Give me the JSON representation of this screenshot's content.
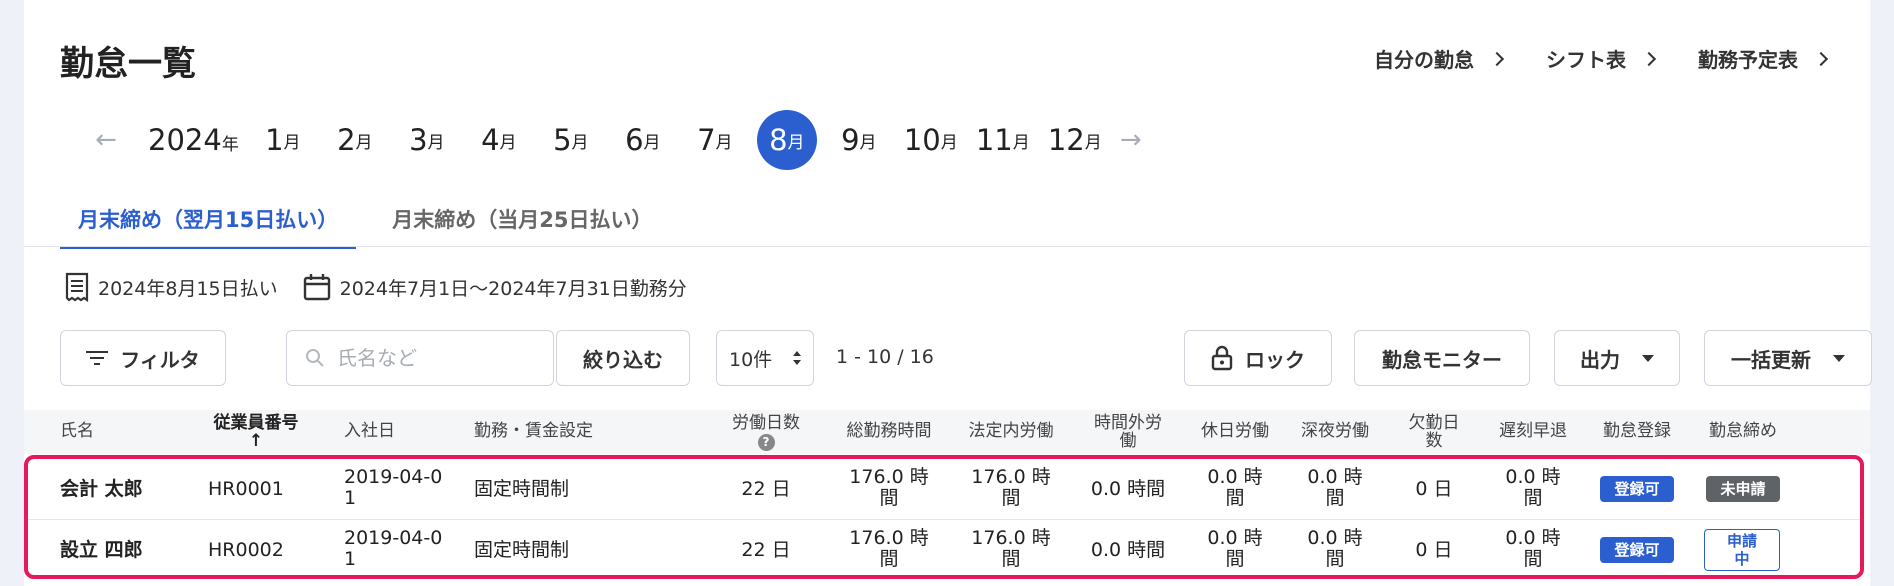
{
  "page": {
    "title": "勤怠一覧"
  },
  "top_links": [
    {
      "label": "自分の勤怠"
    },
    {
      "label": "シフト表"
    },
    {
      "label": "勤務予定表"
    }
  ],
  "calendar": {
    "year": "2024",
    "year_unit": "年",
    "month_unit": "月",
    "months": [
      "1",
      "2",
      "3",
      "4",
      "5",
      "6",
      "7",
      "8",
      "9",
      "10",
      "11",
      "12"
    ],
    "selected": "8"
  },
  "tabs": [
    {
      "label": "月末締め（翌月15日払い）",
      "active": true
    },
    {
      "label": "月末締め（当月25日払い）",
      "active": false
    }
  ],
  "info": {
    "pay_date": "2024年8月15日払い",
    "work_period": "2024年7月1日～2024年7月31日勤務分"
  },
  "toolbar": {
    "filter_label": "フィルタ",
    "search_placeholder": "氏名など",
    "narrow_label": "絞り込む",
    "per_page": "10件",
    "pagination": "1 - 10 / 16",
    "lock_label": "ロック",
    "monitor_label": "勤怠モニター",
    "output_label": "出力",
    "bulk_label": "一括更新"
  },
  "table": {
    "headers": {
      "name": "氏名",
      "emp_no": "従業員番号",
      "sort_arrow": "↑",
      "join_date": "入社日",
      "work_setting": "勤務・賃金設定",
      "work_days": "労働日数",
      "total_hours": "総勤務時間",
      "legal_hours": "法定内労働",
      "overtime_1": "時間外労",
      "overtime_2": "働",
      "holiday": "休日労働",
      "night": "深夜労働",
      "absent_1": "欠勤日",
      "absent_2": "数",
      "late": "遅刻早退",
      "registration": "勤怠登録",
      "closing": "勤怠締め"
    },
    "rows": [
      {
        "name": "会計 太郎",
        "emp_no": "HR0001",
        "join_1": "2019-04-0",
        "join_2": "1",
        "setting": "固定時間制",
        "days": "22 日",
        "total_1": "176.0 時",
        "total_2": "間",
        "legal_1": "176.0 時",
        "legal_2": "間",
        "overtime": "0.0 時間",
        "holiday_1": "0.0 時",
        "holiday_2": "間",
        "night_1": "0.0 時",
        "night_2": "間",
        "absent": "0 日",
        "late_1": "0.0 時",
        "late_2": "間",
        "reg": "登録可",
        "close_1": "未申請",
        "close_2": ""
      },
      {
        "name": "設立 四郎",
        "emp_no": "HR0002",
        "join_1": "2019-04-0",
        "join_2": "1",
        "setting": "固定時間制",
        "days": "22 日",
        "total_1": "176.0 時",
        "total_2": "間",
        "legal_1": "176.0 時",
        "legal_2": "間",
        "overtime": "0.0 時間",
        "holiday_1": "0.0 時",
        "holiday_2": "間",
        "night_1": "0.0 時",
        "night_2": "間",
        "absent": "0 日",
        "late_1": "0.0 時",
        "late_2": "間",
        "reg": "登録可",
        "close_1": "申請",
        "close_2": "中"
      }
    ]
  },
  "colors": {
    "accent": "#2b5fd0",
    "highlight": "#e4185a",
    "gray_badge": "#5f6368"
  }
}
